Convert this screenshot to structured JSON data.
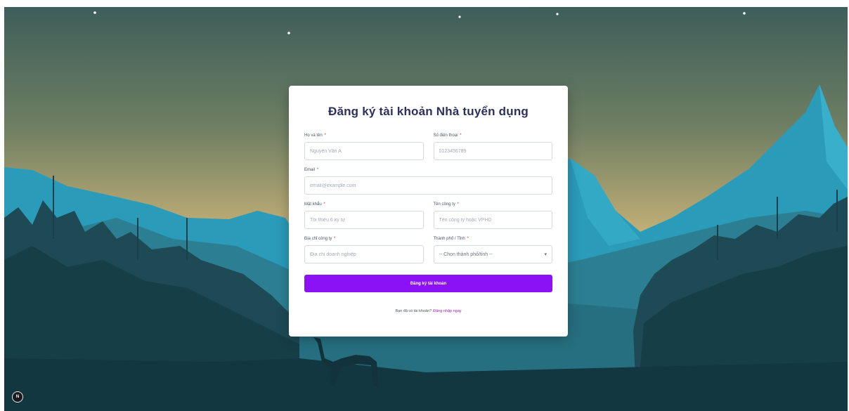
{
  "page": {
    "title": "Đăng ký tài khoản Nhà tuyển dụng"
  },
  "form": {
    "full_name": {
      "label": "Họ và tên",
      "placeholder": "Nguyễn Văn A"
    },
    "phone": {
      "label": "Số điện thoại",
      "placeholder": "0123456789"
    },
    "email": {
      "label": "Email",
      "placeholder": "email@example.com"
    },
    "password": {
      "label": "Mật khẩu",
      "placeholder": "Tối thiểu 6 ký tự"
    },
    "company_name": {
      "label": "Tên công ty",
      "placeholder": "Tên công ty hoặc VPHD"
    },
    "company_address": {
      "label": "Địa chỉ công ty",
      "placeholder": "Địa chỉ doanh nghiệp"
    },
    "city": {
      "label": "Thành phố / Tỉnh",
      "selected": "-- Chọn thành phố/tỉnh --"
    },
    "required_mark": "*",
    "submit_label": "Đăng ký tài khoản"
  },
  "footer": {
    "question": "Bạn đã có tài khoản?",
    "login_link": "Đăng nhập ngay"
  },
  "widget": {
    "badge": "N"
  },
  "colors": {
    "accent": "#8b12f5",
    "title": "#2d2f5e",
    "link": "#a21caf",
    "sky_top": "#3d5c5a",
    "sky_bottom": "#e8c98a"
  },
  "icons": {
    "select_caret": "chevron-down-icon",
    "floating_widget": "n-logo-icon"
  }
}
